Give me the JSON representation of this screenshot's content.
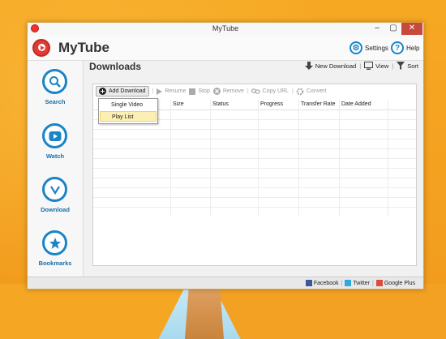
{
  "window": {
    "title": "MyTube"
  },
  "header": {
    "app_name": "MyTube",
    "settings_label": "Settings",
    "help_label": "Help"
  },
  "sidebar": {
    "items": [
      {
        "label": "Search",
        "icon": "search-icon"
      },
      {
        "label": "Watch",
        "icon": "play-icon"
      },
      {
        "label": "Download",
        "icon": "download-icon"
      },
      {
        "label": "Bookmarks",
        "icon": "star-icon"
      }
    ]
  },
  "main": {
    "title": "Downloads",
    "actions": {
      "new_download": "New Download",
      "view": "View",
      "sort": "Sort"
    }
  },
  "toolbar": {
    "add_download": "Add Download",
    "resume": "Resume",
    "stop": "Stop",
    "remove": "Remove",
    "copy_url": "Copy URL",
    "convert": "Convert"
  },
  "dropdown": {
    "items": [
      "Single Video",
      "Play List"
    ],
    "highlighted": "Play List"
  },
  "table": {
    "columns": [
      "Size",
      "Status",
      "Progress",
      "Transfer Rate",
      "Date Added"
    ]
  },
  "statusbar": {
    "facebook": "Facebook",
    "twitter": "Twitter",
    "google_plus": "Google Plus"
  },
  "colors": {
    "accent": "#1a84c7",
    "brand_red": "#e23b34",
    "desktop": "#f4a020"
  }
}
